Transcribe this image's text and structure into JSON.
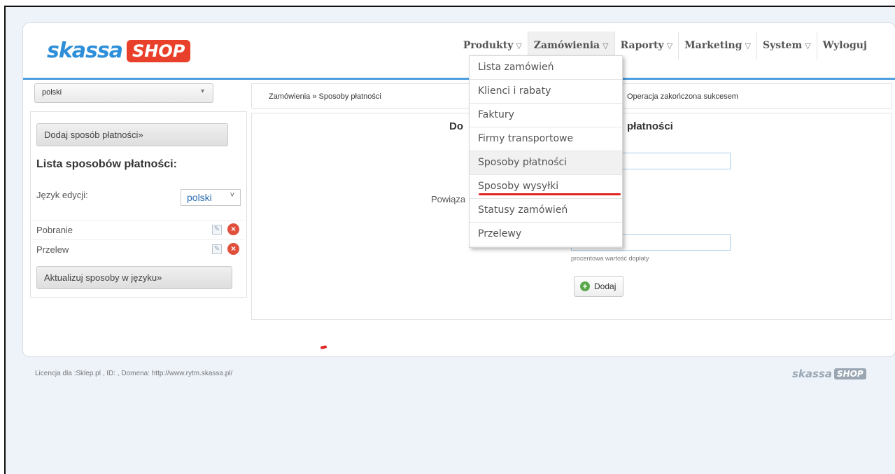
{
  "logo": {
    "part1": "skassa",
    "part2": "SHOP"
  },
  "nav": [
    {
      "label": "Produkty"
    },
    {
      "label": "Zamówienia"
    },
    {
      "label": "Raporty"
    },
    {
      "label": "Marketing"
    },
    {
      "label": "System"
    },
    {
      "label": "Wyloguj"
    }
  ],
  "language_select": {
    "value": "polski"
  },
  "sidebar": {
    "add_button": "Dodaj sposób płatności»",
    "list_title": "Lista sposobów płatności:",
    "lang_label": "Język edycji:",
    "lang_value": "polski",
    "methods": [
      {
        "label": "Pobranie"
      },
      {
        "label": "Przelew"
      }
    ],
    "update_button": "Aktualizuj sposoby w języku»"
  },
  "breadcrumb": {
    "text": "Zamówienia » Sposoby płatności"
  },
  "status": {
    "text": "Operacja zakończona sukcesem"
  },
  "content": {
    "title_left": "Do",
    "title_right": "płatności",
    "field_label": "Powiąza",
    "hint": "procentowa wartość dopłaty",
    "add_button": "Dodaj"
  },
  "dropdown": {
    "items": [
      {
        "label": "Lista zamówień"
      },
      {
        "label": "Klienci i rabaty"
      },
      {
        "label": "Faktury"
      },
      {
        "label": "Firmy transportowe"
      },
      {
        "label": "Sposoby płatności"
      },
      {
        "label": "Sposoby wysyłki"
      },
      {
        "label": "Statusy zamówień"
      },
      {
        "label": "Przelewy"
      }
    ]
  },
  "footer": {
    "license": "Licencja dla :Sklep.pl , ID: , Domena: http://www.rytm.skassa.pl/",
    "logo_part1": "skassa",
    "logo_part2": "SHOP"
  },
  "colors": {
    "accent": "#4d9fe0",
    "brand_red": "#e8402b",
    "annotation_red": "#e02424"
  }
}
